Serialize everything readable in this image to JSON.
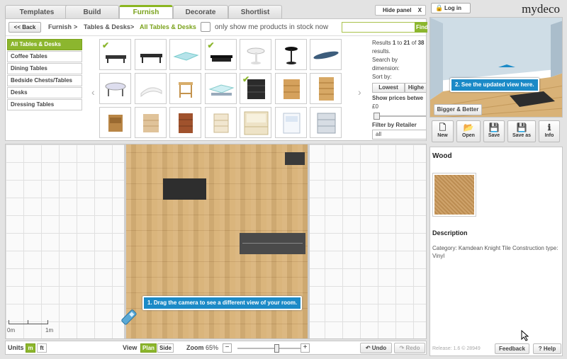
{
  "tabs": [
    {
      "label": "Templates",
      "active": false
    },
    {
      "label": "Build",
      "active": false
    },
    {
      "label": "Furnish",
      "active": true
    },
    {
      "label": "Decorate",
      "active": false
    },
    {
      "label": "Shortlist",
      "active": false
    }
  ],
  "hide_panel": {
    "label": "Hide panel",
    "close": "X"
  },
  "login": {
    "label": "Log in"
  },
  "logo": "mydeco",
  "breadcrumb": {
    "back": "<< Back",
    "items": [
      "Furnish",
      "Tables & Desks",
      "All Tables & Desks"
    ],
    "sep": ">"
  },
  "stock_filter": {
    "label": "only show me products in stock now",
    "checked": false
  },
  "search": {
    "value": "",
    "button": "Find"
  },
  "categories": [
    {
      "label": "All Tables & Desks",
      "active": true
    },
    {
      "label": "Coffee Tables",
      "active": false
    },
    {
      "label": "Dining Tables",
      "active": false
    },
    {
      "label": "Bedside Chests/Tables",
      "active": false
    },
    {
      "label": "Desks",
      "active": false
    },
    {
      "label": "Dressing Tables",
      "active": false
    }
  ],
  "pager": {
    "prev": "‹",
    "next": "›"
  },
  "results": {
    "prefix": "Results",
    "from": "1",
    "to_word": "to",
    "to": "21",
    "of_word": "of",
    "total": "38",
    "suffix": "results.",
    "search_by": "Search by dimension:",
    "sort_by": "Sort by:",
    "lowest": "Lowest",
    "highest": "Highe",
    "show_prices": "Show prices betwe",
    "price_min": "£0",
    "retailer_label": "Filter by Retailer",
    "retailer_value": "all"
  },
  "products": [
    {
      "kind": "low-table-dark",
      "checked": true
    },
    {
      "kind": "coffee-table-dark",
      "checked": false
    },
    {
      "kind": "glass-table",
      "checked": false
    },
    {
      "kind": "low-table-black",
      "checked": true
    },
    {
      "kind": "round-white-table",
      "checked": false
    },
    {
      "kind": "round-black-table",
      "checked": false
    },
    {
      "kind": "surfboard-table",
      "checked": false
    },
    {
      "kind": "oval-glass-table",
      "checked": false
    },
    {
      "kind": "white-curve-table",
      "checked": false
    },
    {
      "kind": "side-table-wood",
      "checked": false
    },
    {
      "kind": "glass-coffee-table",
      "checked": false
    },
    {
      "kind": "black-drawers",
      "checked": true
    },
    {
      "kind": "pine-chest",
      "checked": false
    },
    {
      "kind": "pine-chest-tall",
      "checked": false
    },
    {
      "kind": "bedside-wood",
      "checked": false
    },
    {
      "kind": "bedside-light",
      "checked": false
    },
    {
      "kind": "bedside-cherry",
      "checked": false
    },
    {
      "kind": "bedside-cream",
      "checked": false
    },
    {
      "kind": "dresser-cream",
      "checked": false
    },
    {
      "kind": "bedside-white",
      "checked": false
    },
    {
      "kind": "mirror-chest",
      "checked": false
    }
  ],
  "canvas": {
    "tip_camera": "1. Drag the camera to see a different view of your room.",
    "scale_0": "0m",
    "scale_1": "1m"
  },
  "bottom": {
    "units_label": "Units",
    "unit_m": "m",
    "unit_ft": "ft",
    "view_label": "View",
    "view_plan": "Plan",
    "view_side": "Side",
    "zoom_label": "Zoom",
    "zoom_value": "65%",
    "zoom_minus": "−",
    "zoom_plus": "+",
    "zoom_level": 0.65,
    "undo": "Undo",
    "redo": "Redo"
  },
  "view3d": {
    "tip_view": "2. See the updated view here.",
    "preset": "Bigger & Better"
  },
  "toolbar": [
    {
      "label": "New",
      "icon": "new-file-icon",
      "glyph": "🗋"
    },
    {
      "label": "Open",
      "icon": "folder-icon",
      "glyph": "📂"
    },
    {
      "label": "Save",
      "icon": "save-icon",
      "glyph": "💾"
    },
    {
      "label": "Save as",
      "icon": "save-as-icon",
      "glyph": "💾"
    },
    {
      "label": "Info",
      "icon": "info-icon",
      "glyph": "ℹ"
    }
  ],
  "properties": {
    "title": "Wood",
    "description_heading": "Description",
    "description": "Category: Kamdean Knight Tile Construction type: Vinyl",
    "release": "Release: 1.6 © 28949"
  },
  "footer_buttons": {
    "feedback": "Feedback",
    "help": "Help",
    "help_glyph": "?"
  },
  "colors": {
    "accent": "#8cb62e",
    "tooltip": "#1b8ac7",
    "floor": "#d9b277",
    "furniture": "#3a3a3a"
  }
}
